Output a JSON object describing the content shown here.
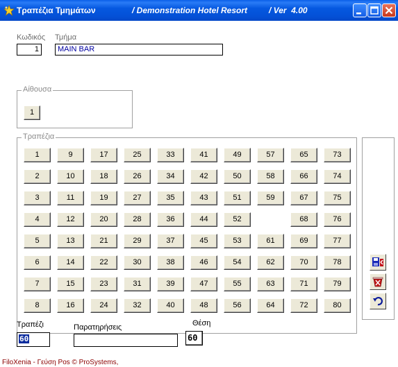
{
  "titlebar": {
    "app": "Τραπέζια Τμημάτων",
    "hotel": "/ Demonstration Hotel Resort",
    "version": "/ Ver  4.00"
  },
  "form": {
    "code_label": "Κωδικός",
    "code_value": "1",
    "dept_label": "Τμήμα",
    "dept_value": "MAIN BAR"
  },
  "hall": {
    "legend": "Αίθουσα",
    "button": "1"
  },
  "tables": {
    "legend": "Τραπέζια",
    "rows": [
      [
        "1",
        "9",
        "17",
        "25",
        "33",
        "41",
        "49",
        "57",
        "65",
        "73"
      ],
      [
        "2",
        "10",
        "18",
        "26",
        "34",
        "42",
        "50",
        "58",
        "66",
        "74"
      ],
      [
        "3",
        "11",
        "19",
        "27",
        "35",
        "43",
        "51",
        "59",
        "67",
        "75"
      ],
      [
        "4",
        "12",
        "20",
        "28",
        "36",
        "44",
        "52",
        "",
        "68",
        "76"
      ],
      [
        "5",
        "13",
        "21",
        "29",
        "37",
        "45",
        "53",
        "61",
        "69",
        "77"
      ],
      [
        "6",
        "14",
        "22",
        "30",
        "38",
        "46",
        "54",
        "62",
        "70",
        "78"
      ],
      [
        "7",
        "15",
        "23",
        "31",
        "39",
        "47",
        "55",
        "63",
        "71",
        "79"
      ],
      [
        "8",
        "16",
        "24",
        "32",
        "40",
        "48",
        "56",
        "64",
        "72",
        "80"
      ]
    ]
  },
  "bottom": {
    "table_label": "Τραπέζι",
    "table_value": "60",
    "notes_label": "Παρατηρήσεις",
    "notes_value": "",
    "position_label": "Θέση",
    "position_value": "60"
  },
  "tools": {
    "save_icon": "save-exit-icon",
    "delete_icon": "delete-icon",
    "undo_icon": "undo-icon"
  },
  "footer": "FiloXenia - Γεύση Pos © ProSystems,"
}
